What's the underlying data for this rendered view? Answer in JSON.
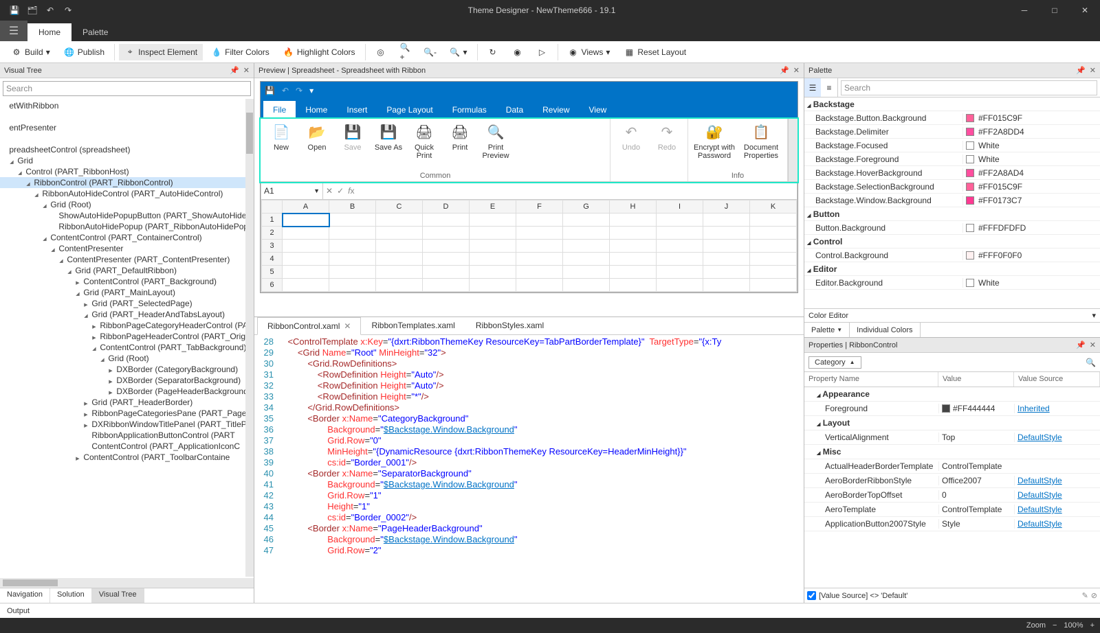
{
  "titlebar": {
    "title": "Theme Designer  -  NewTheme666 - 19.1"
  },
  "mainTabs": {
    "home": "Home",
    "palette": "Palette"
  },
  "toolbar": {
    "build": "Build",
    "publish": "Publish",
    "inspect": "Inspect Element",
    "filter": "Filter Colors",
    "highlight": "Highlight Colors",
    "views": "Views",
    "reset": "Reset Layout"
  },
  "leftPanel": {
    "title": "Visual Tree",
    "searchPlaceholder": "Search",
    "bottomTabs": {
      "nav": "Navigation",
      "sol": "Solution",
      "vt": "Visual Tree"
    },
    "nodes": [
      {
        "indent": 0,
        "exp": "",
        "text": "etWithRibbon"
      },
      {
        "indent": 0,
        "exp": "",
        "text": " "
      },
      {
        "indent": 0,
        "exp": "",
        "text": "entPresenter"
      },
      {
        "indent": 0,
        "exp": "",
        "text": " "
      },
      {
        "indent": 0,
        "exp": "",
        "text": "preadsheetControl (spreadsheet)"
      },
      {
        "indent": 1,
        "exp": "d",
        "text": "Grid"
      },
      {
        "indent": 2,
        "exp": "d",
        "text": "Control (PART_RibbonHost)"
      },
      {
        "indent": 3,
        "exp": "d",
        "text": "RibbonControl (PART_RibbonControl)",
        "sel": true
      },
      {
        "indent": 4,
        "exp": "d",
        "text": "RibbonAutoHideControl (PART_AutoHideControl)"
      },
      {
        "indent": 5,
        "exp": "d",
        "text": "Grid (Root)"
      },
      {
        "indent": 6,
        "exp": "",
        "text": "ShowAutoHidePopupButton (PART_ShowAutoHideP..."
      },
      {
        "indent": 6,
        "exp": "",
        "text": "RibbonAutoHidePopup (PART_RibbonAutoHidePopu"
      },
      {
        "indent": 5,
        "exp": "d",
        "text": "ContentControl (PART_ContainerControl)"
      },
      {
        "indent": 6,
        "exp": "d",
        "text": "ContentPresenter"
      },
      {
        "indent": 7,
        "exp": "d",
        "text": "ContentPresenter (PART_ContentPresenter)"
      },
      {
        "indent": 8,
        "exp": "d",
        "text": "Grid (PART_DefaultRibbon)"
      },
      {
        "indent": 9,
        "exp": "r",
        "text": "ContentControl (PART_Background)"
      },
      {
        "indent": 9,
        "exp": "d",
        "text": "Grid (PART_MainLayout)"
      },
      {
        "indent": 10,
        "exp": "r",
        "text": "Grid (PART_SelectedPage)"
      },
      {
        "indent": 10,
        "exp": "d",
        "text": "Grid (PART_HeaderAndTabsLayout)"
      },
      {
        "indent": 11,
        "exp": "r",
        "text": "RibbonPageCategoryHeaderControl (PA"
      },
      {
        "indent": 11,
        "exp": "r",
        "text": "RibbonPageHeaderControl (PART_Origi"
      },
      {
        "indent": 11,
        "exp": "d",
        "text": "ContentControl (PART_TabBackground)"
      },
      {
        "indent": 12,
        "exp": "d",
        "text": "Grid (Root)"
      },
      {
        "indent": 13,
        "exp": "r",
        "text": "DXBorder (CategoryBackground)"
      },
      {
        "indent": 13,
        "exp": "r",
        "text": "DXBorder (SeparatorBackground)"
      },
      {
        "indent": 13,
        "exp": "r",
        "text": "DXBorder (PageHeaderBackground)"
      },
      {
        "indent": 10,
        "exp": "r",
        "text": "Grid (PART_HeaderBorder)"
      },
      {
        "indent": 10,
        "exp": "r",
        "text": "RibbonPageCategoriesPane (PART_Page"
      },
      {
        "indent": 10,
        "exp": "r",
        "text": "DXRibbonWindowTitlePanel (PART_TitleP"
      },
      {
        "indent": 10,
        "exp": "",
        "text": "RibbonApplicationButtonControl (PART"
      },
      {
        "indent": 10,
        "exp": "",
        "text": "ContentControl (PART_ApplicationIconC"
      },
      {
        "indent": 9,
        "exp": "r",
        "text": "ContentControl (PART_ToolbarContaine"
      }
    ]
  },
  "preview": {
    "title": "Preview | Spreadsheet - Spreadsheet with Ribbon",
    "ribbonTabs": [
      "File",
      "Home",
      "Insert",
      "Page Layout",
      "Formulas",
      "Data",
      "Review",
      "View"
    ],
    "group1": {
      "new": "New",
      "open": "Open",
      "save": "Save",
      "saveas": "Save As",
      "quick": "Quick Print",
      "print": "Print",
      "preview": "Print Preview",
      "label": "Common"
    },
    "group2": {
      "undo": "Undo",
      "redo": "Redo"
    },
    "group3": {
      "encrypt": "Encrypt with Password",
      "docprops": "Document Properties",
      "label": "Info"
    },
    "namebox": "A1",
    "cols": [
      "A",
      "B",
      "C",
      "D",
      "E",
      "F",
      "G",
      "H",
      "I",
      "J",
      "K"
    ],
    "rows": [
      "1",
      "2",
      "3",
      "4",
      "5",
      "6"
    ]
  },
  "code": {
    "tabs": {
      "t1": "RibbonControl.xaml",
      "t2": "RibbonTemplates.xaml",
      "t3": "RibbonStyles.xaml"
    },
    "startLine": 28
  },
  "palette": {
    "title": "Palette",
    "searchPlaceholder": "Search",
    "groups": [
      {
        "name": "Backstage",
        "items": [
          {
            "name": "Backstage.Button.Background",
            "color": "#FF015C9F",
            "val": "#FF015C9F"
          },
          {
            "name": "Backstage.Delimiter",
            "color": "#FF2A8DD4",
            "val": "#FF2A8DD4"
          },
          {
            "name": "Backstage.Focused",
            "color": "#FFFFFF",
            "val": "White"
          },
          {
            "name": "Backstage.Foreground",
            "color": "#FFFFFF",
            "val": "White"
          },
          {
            "name": "Backstage.HoverBackground",
            "color": "#FF2A8AD4",
            "val": "#FF2A8AD4"
          },
          {
            "name": "Backstage.SelectionBackground",
            "color": "#FF015C9F",
            "val": "#FF015C9F"
          },
          {
            "name": "Backstage.Window.Background",
            "color": "#FF0173C7",
            "val": "#FF0173C7"
          }
        ]
      },
      {
        "name": "Button",
        "items": [
          {
            "name": "Button.Background",
            "color": "#FFFDFDFD",
            "val": "#FFFDFDFD"
          }
        ]
      },
      {
        "name": "Control",
        "items": [
          {
            "name": "Control.Background",
            "color": "#FFF0F0F0",
            "val": "#FFF0F0F0"
          }
        ]
      },
      {
        "name": "Editor",
        "items": [
          {
            "name": "Editor.Background",
            "color": "#FFFFFF",
            "val": "White"
          }
        ]
      }
    ],
    "colorEditor": "Color Editor",
    "modes": {
      "pal": "Palette",
      "ind": "Individual Colors"
    }
  },
  "props": {
    "title": "Properties | RibbonControl",
    "category": "Category",
    "headers": {
      "name": "Property Name",
      "val": "Value",
      "src": "Value Source"
    },
    "groups": [
      {
        "name": "Appearance",
        "rows": [
          {
            "name": "Foreground",
            "val": "#FF444444",
            "swatch": "#444444",
            "src": "Inherited",
            "link": true
          }
        ]
      },
      {
        "name": "Layout",
        "rows": [
          {
            "name": "VerticalAlignment",
            "val": "Top",
            "src": "DefaultStyle",
            "link": true
          }
        ]
      },
      {
        "name": "Misc",
        "rows": [
          {
            "name": "ActualHeaderBorderTemplate",
            "val": "ControlTemplate",
            "src": ""
          },
          {
            "name": "AeroBorderRibbonStyle",
            "val": "Office2007",
            "src": "DefaultStyle",
            "link": true
          },
          {
            "name": "AeroBorderTopOffset",
            "val": "0",
            "src": "DefaultStyle",
            "link": true
          },
          {
            "name": "AeroTemplate",
            "val": "ControlTemplate",
            "src": "DefaultStyle",
            "link": true
          },
          {
            "name": "ApplicationButton2007Style",
            "val": "Style",
            "src": "DefaultStyle",
            "link": true
          }
        ]
      }
    ],
    "footer": "[Value Source] <> 'Default'"
  },
  "output": {
    "label": "Output"
  },
  "status": {
    "zoom": "Zoom",
    "pct": "100%"
  }
}
